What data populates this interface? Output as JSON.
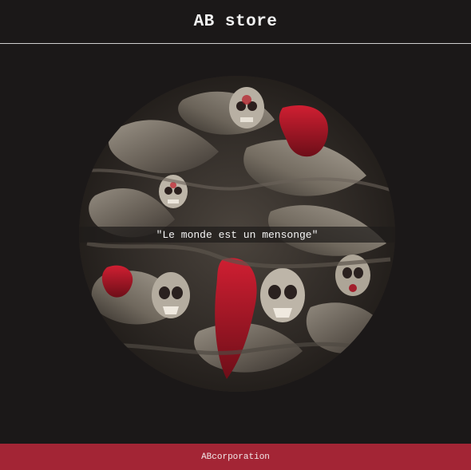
{
  "header": {
    "title": "AB store"
  },
  "hero": {
    "quote": "\"Le monde est un mensonge\"",
    "image_icon": "skull-artwork-icon"
  },
  "footer": {
    "text": "ABcorporation"
  },
  "colors": {
    "background": "#1b1818",
    "divider": "#cfcfcf",
    "footer": "#a32535",
    "accent_red": "#b3202e"
  }
}
